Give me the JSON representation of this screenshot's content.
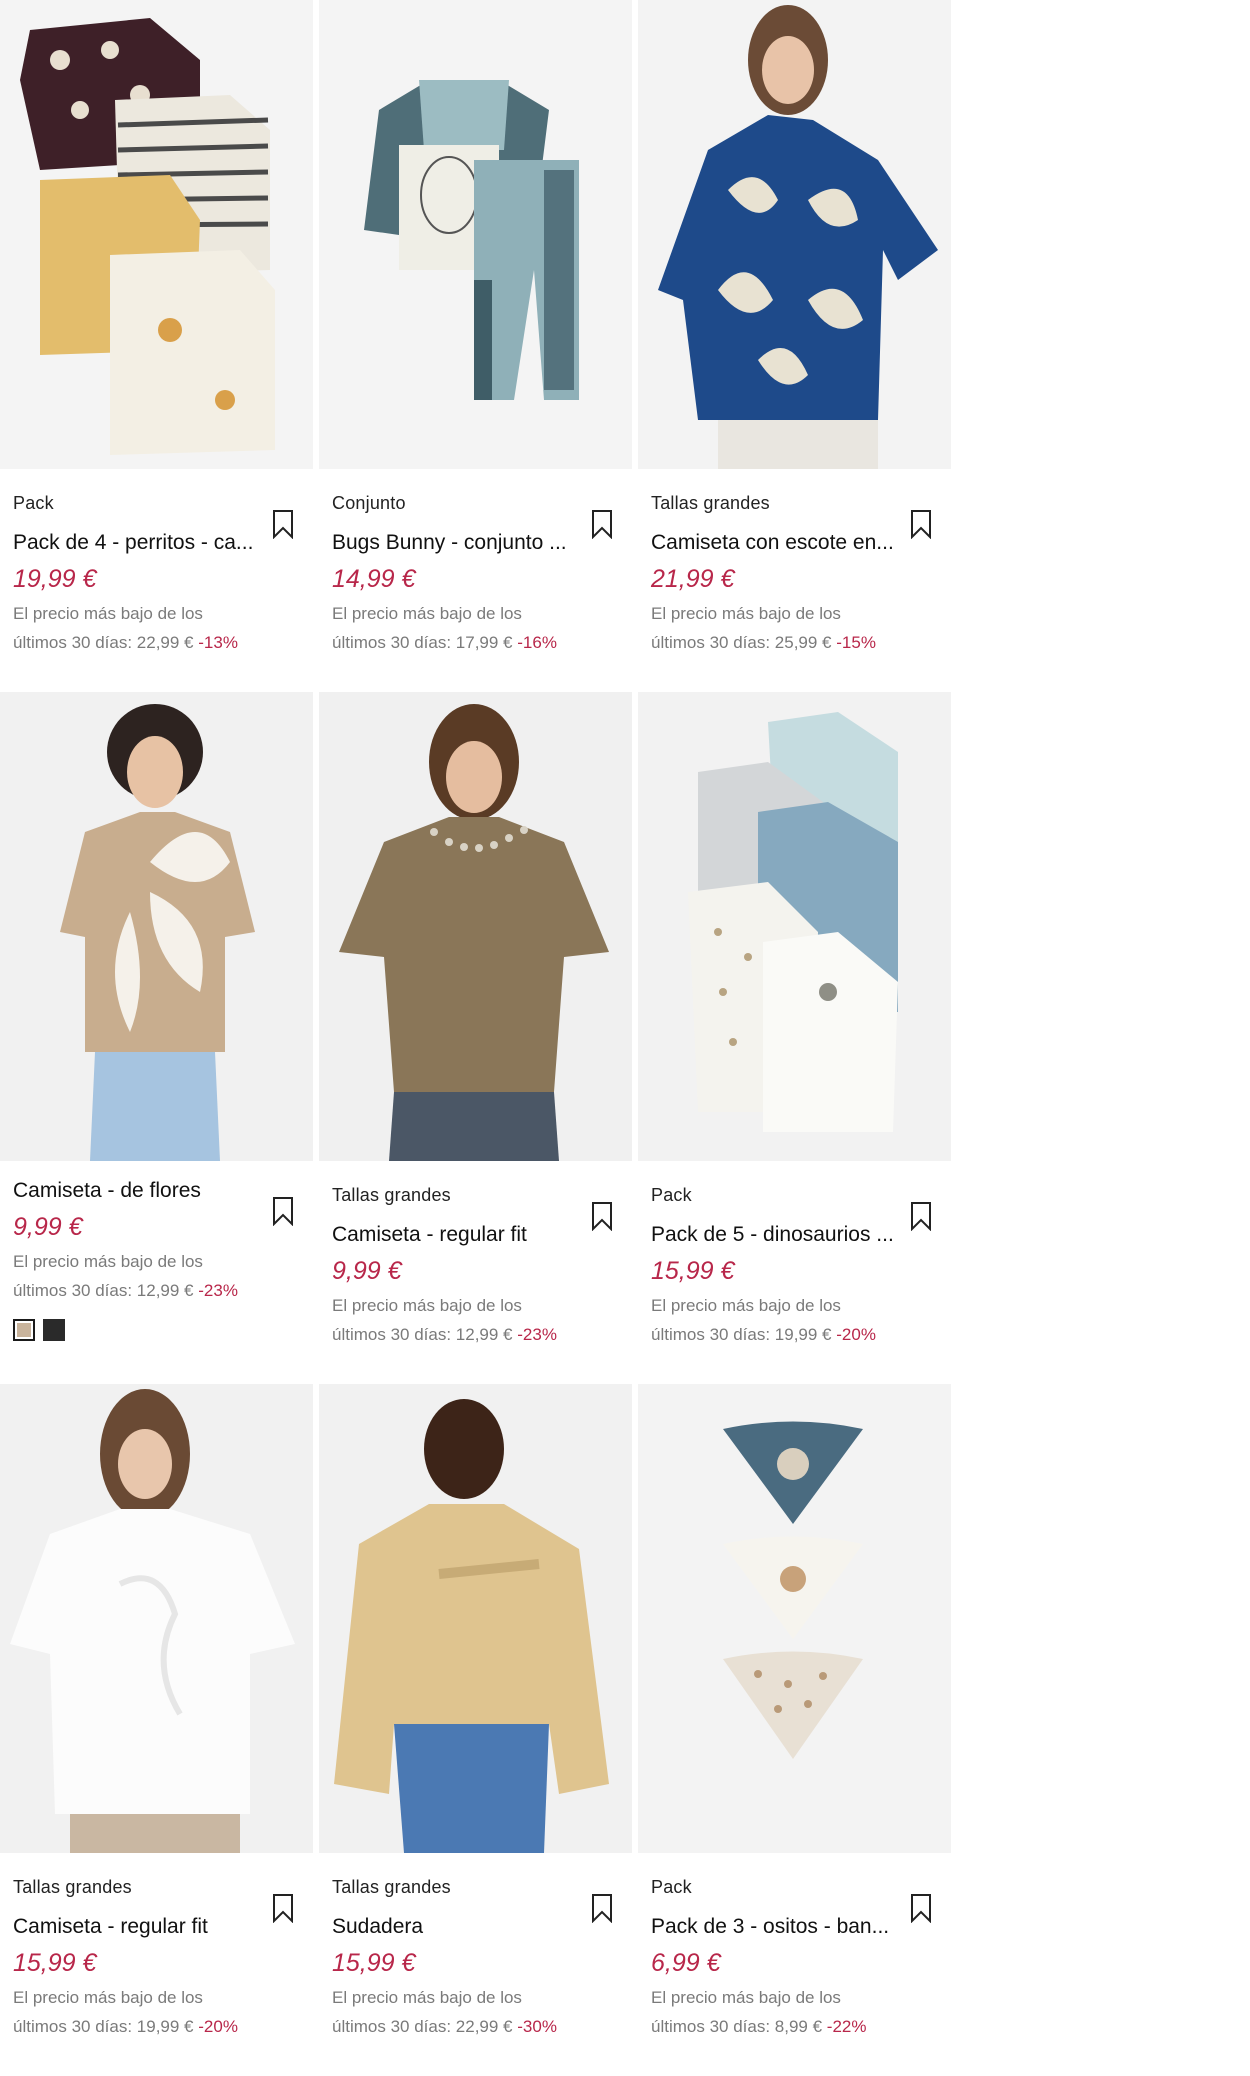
{
  "products": [
    {
      "tag": "Pack",
      "title": "Pack de 4 - perritos - ca...",
      "price": "19,99 €",
      "low_line1": "El precio más bajo de los",
      "low_line2": "últimos 30 días: 22,99 €",
      "discount": "-13%",
      "image": "kids-longsleeve-pack"
    },
    {
      "tag": "Conjunto",
      "title": "Bugs Bunny - conjunto ...",
      "price": "14,99 €",
      "low_line1": "El precio más bajo de los",
      "low_line2": "últimos 30 días: 17,99 €",
      "discount": "-16%",
      "image": "baby-set-bugs-bunny"
    },
    {
      "tag": "Tallas grandes",
      "title": "Camiseta con escote en...",
      "price": "21,99 €",
      "low_line1": "El precio más bajo de los",
      "low_line2": "últimos 30 días: 25,99 €",
      "discount": "-15%",
      "image": "woman-blue-print-top"
    },
    {
      "tag": "",
      "title": "Camiseta - de flores",
      "price": "9,99 €",
      "low_line1": "El precio más bajo de los",
      "low_line2": "últimos 30 días: 12,99 €",
      "discount": "-23%",
      "image": "woman-beige-floral-tee",
      "swatches": [
        "#c9b49c",
        "#2a2a2a"
      ]
    },
    {
      "tag": "Tallas grandes",
      "title": "Camiseta - regular fit",
      "price": "9,99 €",
      "low_line1": "El precio más bajo de los",
      "low_line2": "últimos 30 días: 12,99 €",
      "discount": "-23%",
      "image": "woman-khaki-tee"
    },
    {
      "tag": "Pack",
      "title": "Pack de 5 - dinosaurios ...",
      "price": "15,99 €",
      "low_line1": "El precio más bajo de los",
      "low_line2": "últimos 30 días: 19,99 €",
      "discount": "-20%",
      "image": "baby-bodysuit-pack"
    },
    {
      "tag": "Tallas grandes",
      "title": "Camiseta - regular fit",
      "price": "15,99 €",
      "low_line1": "El precio más bajo de los",
      "low_line2": "últimos 30 días: 19,99 €",
      "discount": "-20%",
      "image": "woman-white-tee"
    },
    {
      "tag": "Tallas grandes",
      "title": "Sudadera",
      "price": "15,99 €",
      "low_line1": "El precio más bajo de los",
      "low_line2": "últimos 30 días: 22,99 €",
      "discount": "-30%",
      "image": "man-yellow-sweatshirt"
    },
    {
      "tag": "Pack",
      "title": "Pack de 3 - ositos - ban...",
      "price": "6,99 €",
      "low_line1": "El precio más bajo de los",
      "low_line2": "últimos 30 días: 8,99 €",
      "discount": "-22%",
      "image": "baby-bibs-pack"
    }
  ],
  "icons": {
    "bookmark": "bookmark-icon"
  },
  "colors": {
    "sale_price": "#b8274a",
    "muted_text": "#7a7a7a",
    "image_bg": "#f2f2f2"
  }
}
